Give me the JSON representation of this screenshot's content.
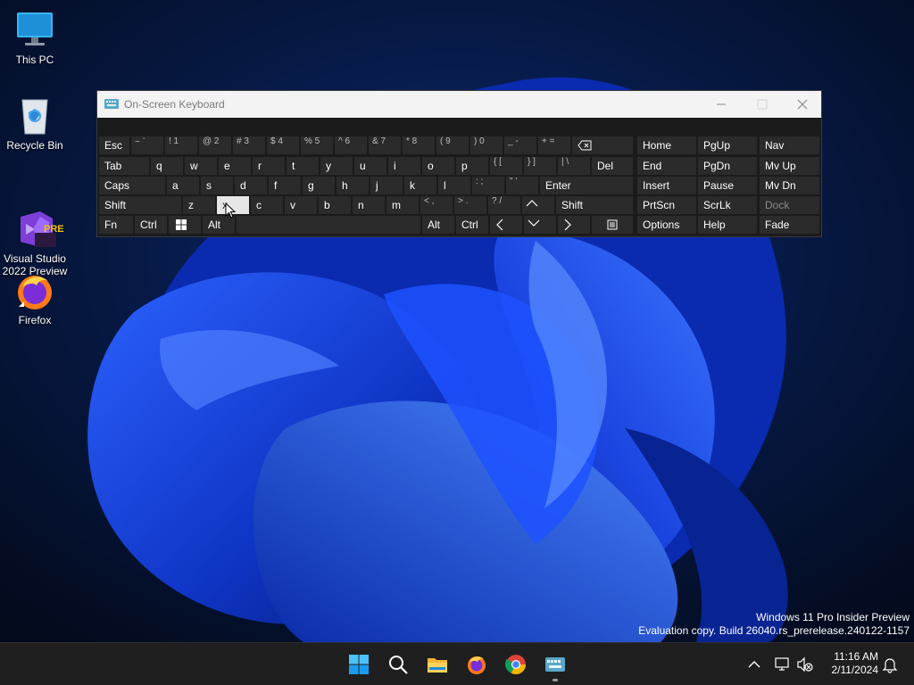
{
  "desktop": {
    "icons": [
      {
        "label": "This PC",
        "icon": "monitor-icon"
      },
      {
        "label": "Recycle Bin",
        "icon": "recycle-bin-icon"
      },
      {
        "label": "Visual Studio\n2022 Preview",
        "icon": "visual-studio-icon",
        "badge": "PRE"
      },
      {
        "label": "Firefox",
        "icon": "firefox-icon"
      }
    ]
  },
  "osk": {
    "title": "On-Screen Keyboard",
    "rows": {
      "row1": [
        "Esc",
        "~ `",
        "! 1",
        "@ 2",
        "# 3",
        "$ 4",
        "% 5",
        "^ 6",
        "& 7",
        "* 8",
        "( 9",
        ") 0",
        "_ -",
        "+ =",
        "backspace-icon"
      ],
      "row2": [
        "Tab",
        "q",
        "w",
        "e",
        "r",
        "t",
        "y",
        "u",
        "i",
        "o",
        "p",
        "{ [",
        "} ]",
        "| \\",
        "Del"
      ],
      "row3": [
        "Caps",
        "a",
        "s",
        "d",
        "f",
        "g",
        "h",
        "j",
        "k",
        "l",
        ": ;",
        "\" '",
        "Enter"
      ],
      "row4": [
        "Shift",
        "z",
        "x",
        "c",
        "v",
        "b",
        "n",
        "m",
        "< ,",
        "> .",
        "? /",
        "up-arrow-icon",
        "Shift"
      ],
      "row5": [
        "Fn",
        "Ctrl",
        "windows-icon",
        "Alt",
        "Alt",
        "Ctrl",
        "left-arrow-icon",
        "down-arrow-icon",
        "right-arrow-icon",
        "menu-icon"
      ]
    },
    "nav_keys": {
      "col1": [
        "Home",
        "End",
        "Insert",
        "PrtScn",
        "Options"
      ],
      "col2": [
        "PgUp",
        "PgDn",
        "Pause",
        "ScrLk",
        "Help"
      ],
      "col3": [
        "Nav",
        "Mv Up",
        "Mv Dn",
        "Dock",
        "Fade"
      ]
    },
    "pressed_key": "x",
    "disabled_key": "Dock"
  },
  "watermark": {
    "line1": "Windows 11 Pro Insider Preview",
    "line2": "Evaluation copy. Build 26040.rs_prerelease.240122-1157"
  },
  "taskbar": {
    "apps": [
      "start-icon",
      "search-icon",
      "file-explorer-icon",
      "firefox-icon",
      "chrome-icon",
      "osk-icon"
    ],
    "active_app": "osk-icon",
    "clock": {
      "time": "11:16 AM",
      "date": "2/11/2024"
    },
    "tray": [
      "chevron-up-icon",
      "network-icon",
      "volume-muted-icon",
      "notification-bell-icon"
    ]
  },
  "colors": {
    "taskbar_bg": "#1f1f1f",
    "osk_bg": "#1b1b1b",
    "osk_key_bg": "#2b2b2b",
    "pressed_key_bg": "#e6e6e6",
    "wallpaper_accent": "#1f4fff"
  }
}
